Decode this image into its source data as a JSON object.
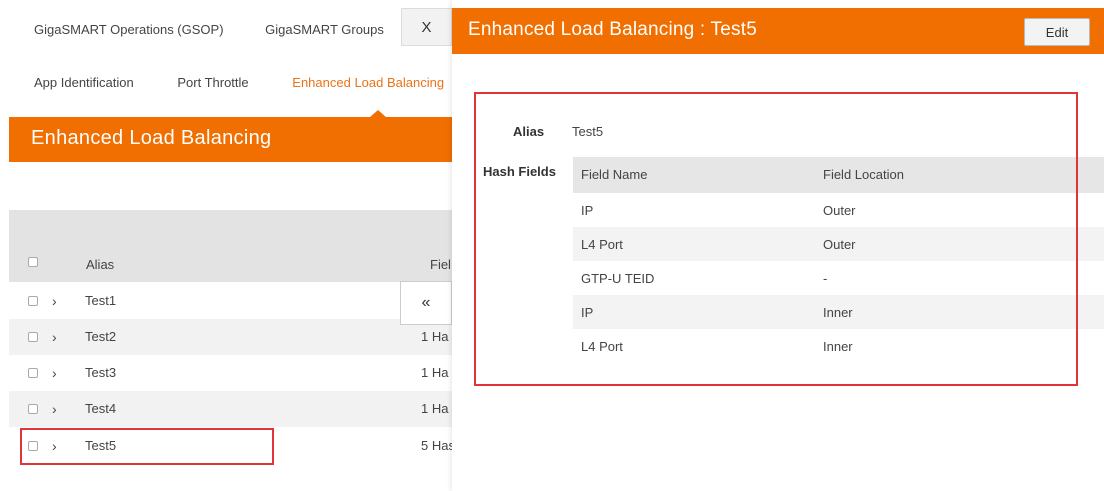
{
  "top_nav": {
    "items": [
      "GigaSMART Operations (GSOP)",
      "GigaSMART Groups"
    ]
  },
  "sub_nav": {
    "items": [
      "App Identification",
      "Port Throttle"
    ],
    "active": "Enhanced Load Balancing"
  },
  "close_tab": {
    "label": "X"
  },
  "section": {
    "title": "Enhanced Load Balancing"
  },
  "list": {
    "col_alias": "Alias",
    "col_field": "Fiel",
    "rows": [
      {
        "alias": "Test1",
        "field": ""
      },
      {
        "alias": "Test2",
        "field": "1 Ha"
      },
      {
        "alias": "Test3",
        "field": "1 Ha"
      },
      {
        "alias": "Test4",
        "field": "1 Ha"
      },
      {
        "alias": "Test5",
        "field": "5 Has"
      }
    ],
    "chevron": "›",
    "collapse_label": "«"
  },
  "panel": {
    "title": "Enhanced Load Balancing : Test5",
    "edit_label": "Edit",
    "alias_label": "Alias",
    "alias_value": "Test5",
    "hash_label": "Hash Fields",
    "table": {
      "headers": [
        "Field Name",
        "Field Location"
      ],
      "rows": [
        [
          "IP",
          "Outer"
        ],
        [
          "L4 Port",
          "Outer"
        ],
        [
          "GTP-U TEID",
          "-"
        ],
        [
          "IP",
          "Inner"
        ],
        [
          "L4 Port",
          "Inner"
        ]
      ]
    }
  },
  "colors": {
    "accent": "#f16e00",
    "highlight": "#e0343a"
  }
}
